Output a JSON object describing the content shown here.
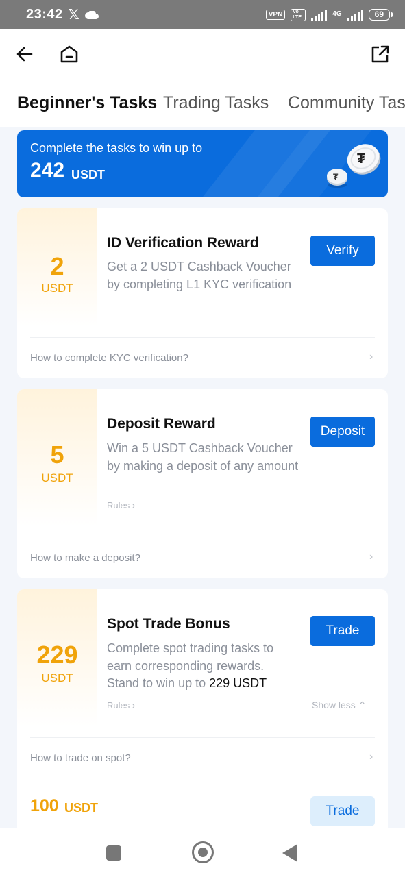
{
  "status_bar": {
    "time": "23:42",
    "x_glyph": "𝕏",
    "vpn": "VPN",
    "volte": "Vo LTE",
    "network": "4G",
    "battery": "69"
  },
  "tabs": [
    {
      "label": "Beginner's Tasks",
      "active": true
    },
    {
      "label": "Trading Tasks",
      "active": false
    },
    {
      "label": "Community Tasks",
      "active": false
    }
  ],
  "banner": {
    "line1": "Complete the tasks to win up to",
    "amount": "242",
    "unit": "USDT"
  },
  "tasks": [
    {
      "amount": "2",
      "unit": "USDT",
      "title": "ID Verification Reward",
      "desc": "Get a 2 USDT Cashback Voucher by completing L1 KYC verification",
      "button": "Verify",
      "how": "How to complete KYC verification?"
    },
    {
      "amount": "5",
      "unit": "USDT",
      "title": "Deposit Reward",
      "desc": "Win a 5 USDT Cashback Voucher by making a deposit of any amount",
      "rules": "Rules ›",
      "button": "Deposit",
      "how": "How to make a deposit?"
    },
    {
      "amount": "229",
      "unit": "USDT",
      "title": "Spot Trade Bonus",
      "desc_prefix": "Complete spot trading tasks to earn corresponding rewards. Stand to win up to ",
      "desc_highlight": "229 USDT",
      "rules": "Rules ›",
      "show_less": "Show less ⌃",
      "button": "Trade",
      "how": "How to trade on spot?",
      "sub_reward": {
        "amount": "100",
        "unit": "USDT",
        "button": "Trade"
      }
    }
  ],
  "chevron": "›",
  "colors": {
    "primary": "#0a6cdd",
    "reward": "#f0a30a",
    "muted_text": "#8a8f99"
  }
}
